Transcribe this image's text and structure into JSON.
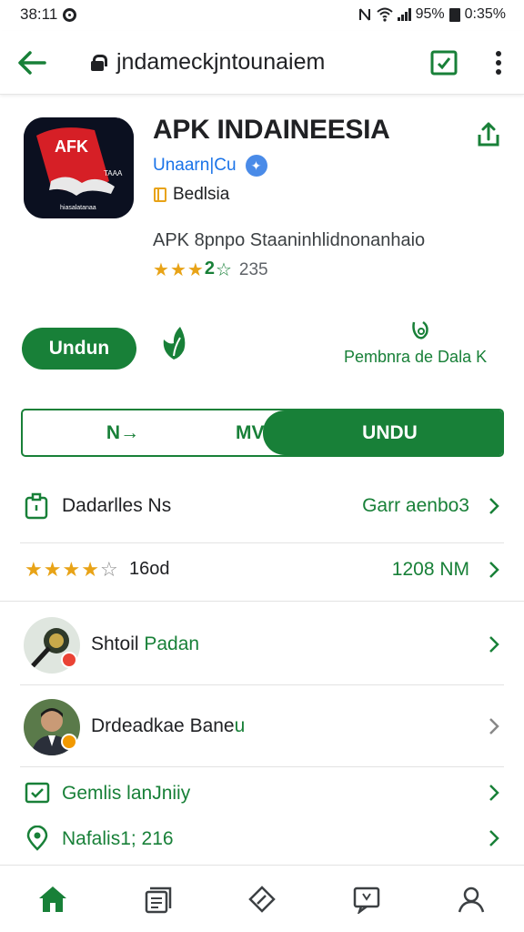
{
  "status_bar": {
    "time": "38:11",
    "battery_text": "95%",
    "extra_text": "0:35%"
  },
  "browser": {
    "url": "jndameckjntounaiem",
    "icons": [
      "back-arrow-icon",
      "lock-icon",
      "tab-switcher-icon",
      "more-vert-icon"
    ]
  },
  "app": {
    "icon_text": "AFK",
    "icon_subtext": "TAAA",
    "icon_caption": "hiasalatanaa",
    "title": "APK INDAINEESIA",
    "developer": "Unaarn|Cu",
    "category": "Bedlsia",
    "description": "APK 8pnpo Staaninhlidnonanhaio",
    "rating_count": "235",
    "rating_inline": "2"
  },
  "actions": {
    "install_label": "Undun",
    "data_safety_label": "Pembnra de Dala K"
  },
  "toggle": {
    "option_a": "N→",
    "option_b": "MV>",
    "option_c": "UNDU"
  },
  "rows": {
    "info_label": "Dadarlles Ns",
    "info_value": "Garr aenbo3",
    "rating_count": "16od",
    "rating_value": "1208 NM",
    "person1_label_a": "Shtoil ",
    "person1_label_b": "Padan",
    "person2_label_a": "Drdeadkae Bane",
    "person2_label_b": "u",
    "item1_label": "Gemlis lanJniiy",
    "item2_label": "Nafalis1; 216"
  },
  "bottom_nav": [
    "home-icon",
    "library-icon",
    "edit-icon",
    "inbox-icon",
    "account-icon"
  ],
  "colors": {
    "accent": "#188038",
    "star": "#e8a317",
    "text": "#202124"
  }
}
